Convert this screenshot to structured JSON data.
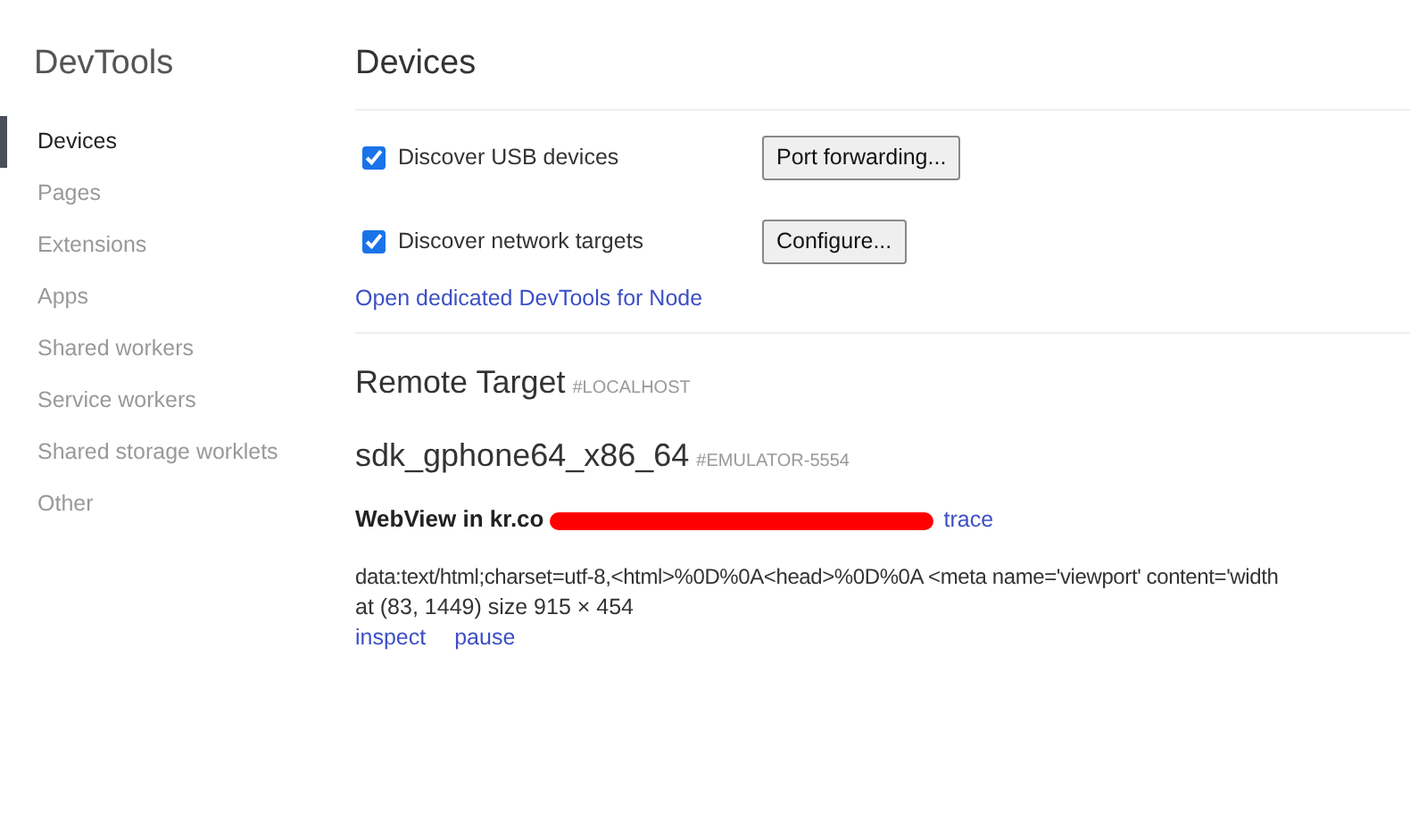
{
  "sidebar": {
    "title": "DevTools",
    "items": [
      {
        "label": "Devices",
        "selected": true
      },
      {
        "label": "Pages",
        "selected": false
      },
      {
        "label": "Extensions",
        "selected": false
      },
      {
        "label": "Apps",
        "selected": false
      },
      {
        "label": "Shared workers",
        "selected": false
      },
      {
        "label": "Service workers",
        "selected": false
      },
      {
        "label": "Shared storage worklets",
        "selected": false
      },
      {
        "label": "Other",
        "selected": false
      }
    ]
  },
  "page": {
    "title": "Devices",
    "options": [
      {
        "label": "Discover USB devices",
        "checked": true,
        "button": "Port forwarding..."
      },
      {
        "label": "Discover network targets",
        "checked": true,
        "button": "Configure..."
      }
    ],
    "node_link": "Open dedicated DevTools for Node",
    "remote": {
      "title": "Remote Target",
      "tag": "#LOCALHOST",
      "device": {
        "name": "sdk_gphone64_x86_64",
        "tag": "#EMULATOR-5554",
        "browser": {
          "title": "WebView in kr.co",
          "redacted": true,
          "action": "trace",
          "target": {
            "url": "data:text/html;charset=utf-8,<html>%0D%0A<head>%0D%0A <meta name='viewport' content='width",
            "position": "at (83, 1449)  size 915 × 454",
            "actions": [
              "inspect",
              "pause"
            ]
          }
        }
      }
    }
  }
}
